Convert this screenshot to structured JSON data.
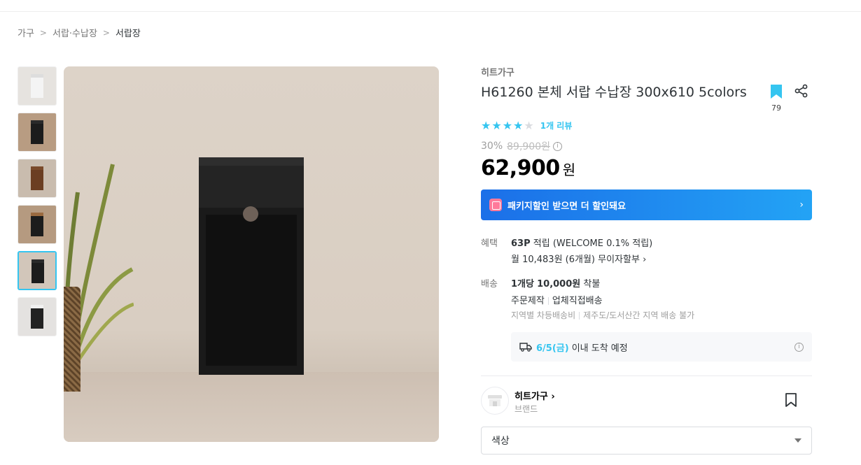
{
  "breadcrumb": [
    "가구",
    "서랍·수납장",
    "서랍장"
  ],
  "product": {
    "brand": "히트가구",
    "title": "H61260 본체 서랍 수납장 300x610 5colors",
    "bookmark_count": "79",
    "rating_stars": 4,
    "review_count": "1개 리뷰",
    "discount": "30%",
    "original_price": "89,900원",
    "price": "62,900",
    "price_unit": "원"
  },
  "package_banner": {
    "text": "패키지할인 받으면 더 할인돼요",
    "color": "#1b6fe8"
  },
  "benefit": {
    "label": "혜택",
    "points": "63P",
    "points_text": "적립 (WELCOME 0.1% 적립)",
    "installment": "월 10,483원 (6개월) 무이자할부"
  },
  "shipping": {
    "label": "배송",
    "fee_prefix": "1개당",
    "fee": "10,000원",
    "fee_suffix": "착불",
    "type1": "주문제작",
    "type2": "업체직접배송",
    "note1": "지역별 차등배송비",
    "note2": "제주도/도서산간 지역 배송 불가",
    "delivery_date": "6/5(금)",
    "delivery_text": "이내 도착 예정"
  },
  "brand_section": {
    "name": "히트가구",
    "sub": "브랜드"
  },
  "option_select": {
    "label": "색상"
  },
  "accent_color": "#35c5f0"
}
